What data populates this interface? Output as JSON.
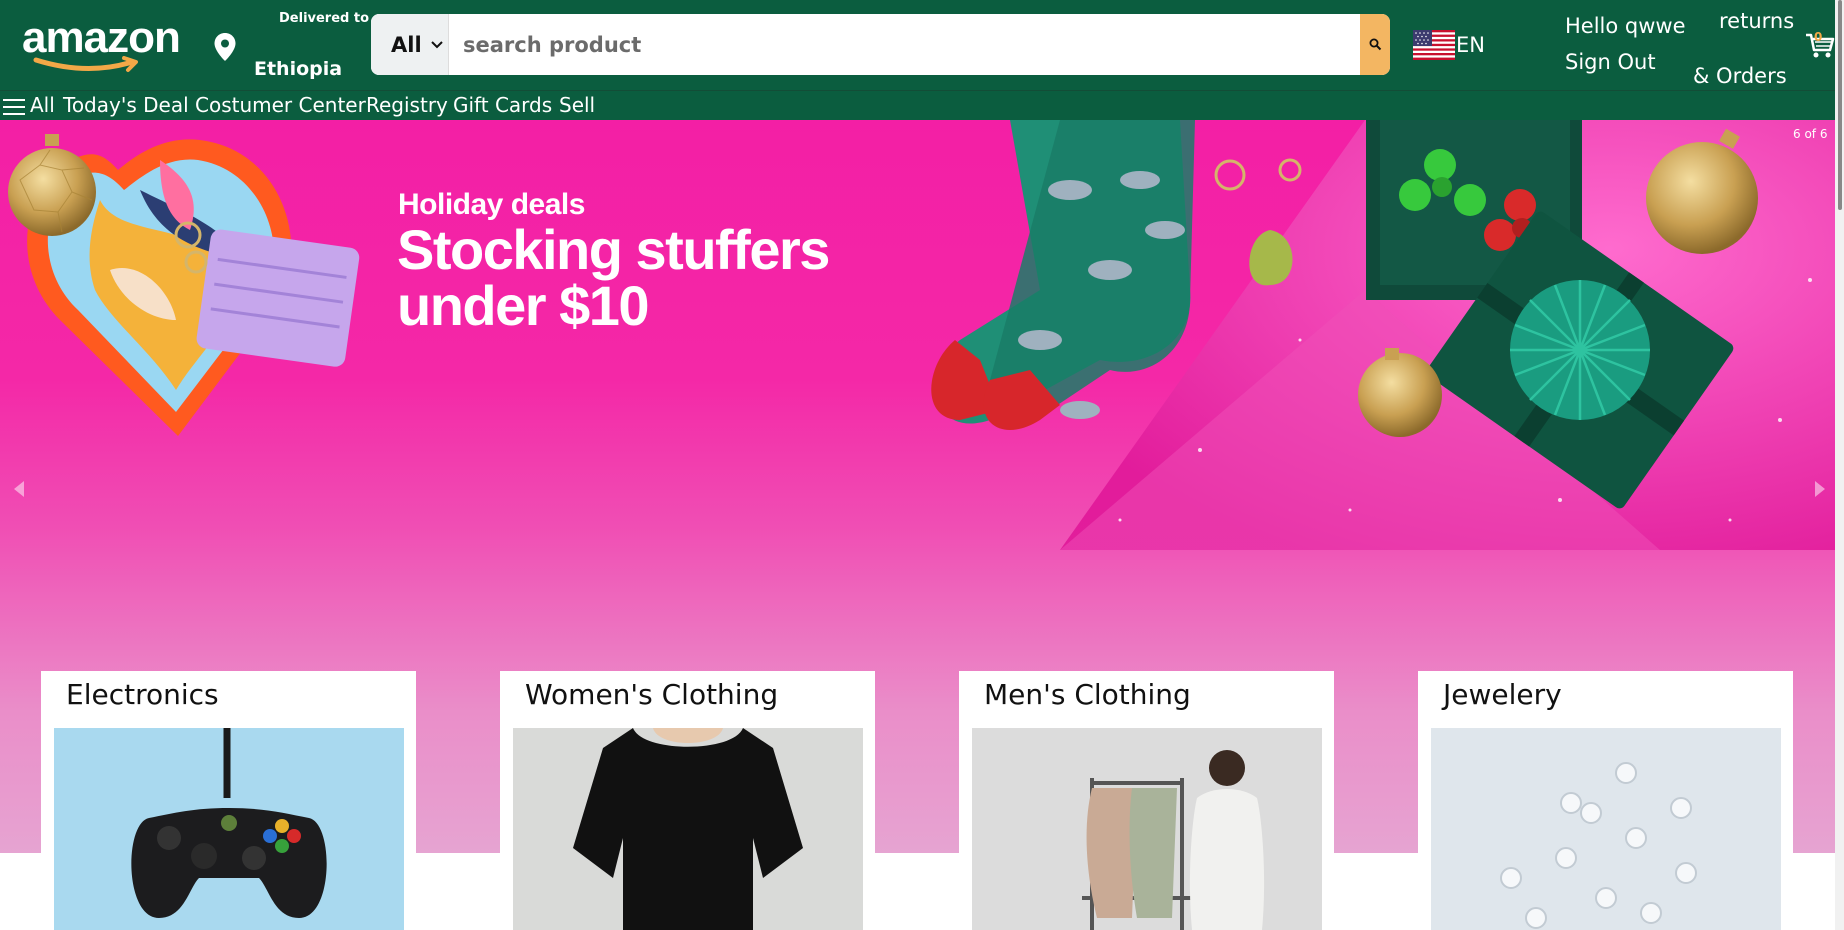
{
  "header": {
    "logo_text": "amazon",
    "deliver_label": "Delivered to",
    "deliver_country": "Ethiopia",
    "search": {
      "category": "All",
      "placeholder": "search product"
    },
    "language": "EN",
    "greeting": "Hello qwwe",
    "sign_out": "Sign Out",
    "returns": "returns",
    "orders": "& Orders",
    "cart_count": "0"
  },
  "nav": {
    "all_label": "All",
    "items": [
      "Today's Deal",
      "Costumer Center",
      "Registry",
      "Gift Cards",
      "Sell"
    ]
  },
  "hero": {
    "subtitle": "Holiday deals",
    "title": "Stocking stuffers under $10",
    "slide_counter": "6 of 6"
  },
  "categories": [
    {
      "title": "Electronics",
      "image_icon": "game-controller"
    },
    {
      "title": "Women's Clothing",
      "image_icon": "black-tshirt"
    },
    {
      "title": "Men's Clothing",
      "image_icon": "clothing-rack"
    },
    {
      "title": "Jewelery",
      "image_icon": "crystal-rings"
    }
  ],
  "colors": {
    "header_bg": "#0b5d3f",
    "search_button": "#f3b662",
    "hero_pink": "#f31fa5",
    "accent_orange": "#f3a847"
  }
}
